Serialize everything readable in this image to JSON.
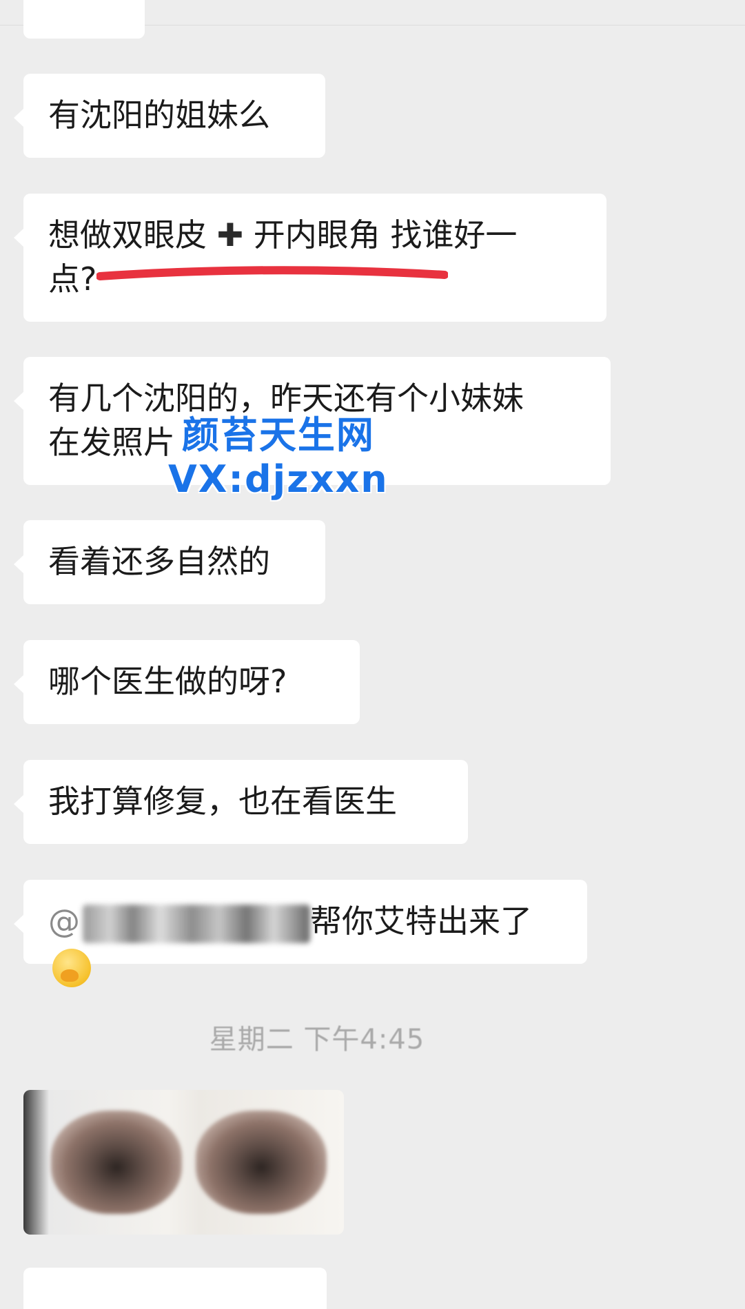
{
  "messages": [
    {
      "text": "有沈阳的姐妹么"
    },
    {
      "line1_a": "想做双眼皮",
      "plus": "✚",
      "line1_b": "开内眼角 找谁好一",
      "line2": "点?"
    },
    {
      "line1": "有几个沈阳的，昨天还有个小妹妹",
      "line2": "在发照片"
    },
    {
      "text": "看着还多自然的"
    },
    {
      "text": "哪个医生做的呀?"
    },
    {
      "text": "我打算修复，也在看医生"
    },
    {
      "mention_prefix": "@",
      "text": "帮你艾特出来了",
      "emoji": "hand-over-mouth-emoji"
    }
  ],
  "watermark": {
    "line1": "颜苔天生网",
    "line2": "VX:djzxxn"
  },
  "timestamp": "星期二 下午4:45",
  "colors": {
    "background": "#ededed",
    "bubble": "#ffffff",
    "text": "#1b1b1b",
    "underline": "#e8323f",
    "watermark": "#1a73e8"
  }
}
